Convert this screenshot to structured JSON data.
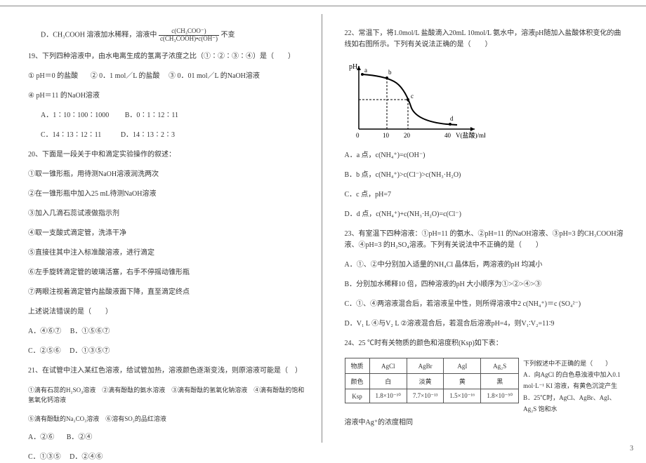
{
  "page_number": "3",
  "left": {
    "frac_num": "c(CH₃COO⁻)",
    "frac_den": "c(CH₃COOH)•c(OH⁻)",
    "optD_prefix": "D．CH₃COOH 溶液加水稀释，溶液中",
    "optD_suffix": "不变",
    "q19_stem": "19、下列四种溶液中，由水电离生成的氢离子浓度之比（①∶②∶③∶④）是（　　）",
    "q19_1": "① pH＝0 的盐酸",
    "q19_2": "② 0．1 mol／L 的盐酸",
    "q19_3": "③ 0．01 mol／L 的NaOH溶液",
    "q19_4": "④ pH＝11 的NaOH溶液",
    "q19_optA": "A．1∶10∶100∶1000",
    "q19_optB": "B．0∶1∶12∶11",
    "q19_optC": "C．14∶13∶12∶11",
    "q19_optD": "D．14∶13∶2∶3",
    "q20_stem": "20、下面是一段关于中和滴定实验操作的叙述：",
    "q20_1": "①取一锥形瓶，用待测NaOH溶液润洗两次",
    "q20_2": "②在一锥形瓶中加入25 mL待测NaOH溶液",
    "q20_3": "③加入几滴石蕊试液做指示剂",
    "q20_4": "④取一支酸式滴定管，洗涤干净",
    "q20_5": "⑤直接往其中注入标准酸溶液，进行滴定",
    "q20_6": "⑥左手旋转滴定管的玻璃活塞，右手不停摇动锥形瓶",
    "q20_7": "⑦两眼注视着滴定管内盐酸液面下降，直至滴定终点",
    "q20_tail": "上述说法错误的是（　　）",
    "q20_optA": "A．④⑥⑦",
    "q20_optB": "B．①⑤⑥⑦",
    "q20_optC": "C．②⑤⑥",
    "q20_optD": "D．①③⑤⑦",
    "q21_stem": "21、在试管中注入某红色溶液，给试管加热，溶液颜色逐渐变浅，则原溶液可能是（　）",
    "q21_opts_line1": "①滴有石蕊的H₂SO₄溶液　②滴有酚酞的氨水溶液　③滴有酚酞的氢氧化钠溶液　④滴有酚酞的饱和氢氧化钙溶液",
    "q21_opts_line2": "⑤滴有酚酞的Na₂CO₃溶液　⑥溶有SO₂的品红溶液",
    "q21_optA": "A．②⑥",
    "q21_optB": "B．②④",
    "q21_optC": "C．①③⑤",
    "q21_optD": "D．②④⑥"
  },
  "right": {
    "q22_stem": "22、常温下，将1.0mol/L 盐酸滴入20mL 10mol/L 氨水中，溶液pH随加入盐酸体积变化的曲线如右图所示。下列有关说法正确的是（　　）",
    "chart_ylabel": "pH",
    "chart_xlabel": "V(盐酸)/mL",
    "q22_a": "A．a 点，c(NH₄⁺)=c(OH⁻)",
    "q22_b": "B．b 点，c(NH₄⁺)>c(Cl⁻)>c(NH₃·H₂O)",
    "q22_c": "C．c 点，pH=7",
    "q22_d": "D．d 点，c(NH₄⁺)+c(NH₃·H₂O)=c(Cl⁻)",
    "q23_stem": "23、有室温下四种溶液：①pH=11 的氨水、②pH=11 的NaOH溶液、③pH=3 的CH₃COOH溶液、④pH=3 的H₂SO₄溶液。下列有关说法中不正确的是（　　）",
    "q23_a": "A．①、②中分别加入适量的NH₄Cl 晶体后，两溶液的pH 均减小",
    "q23_b": "B．分别加水稀释10 倍，四种溶液的pH 大小顺序为①>②>④>③",
    "q23_c": "C．①、④两溶液混合后，若溶液呈中性，则所得溶液中2 c(NH₄⁺)＝c (SO₄²⁻)",
    "q23_d": "D．V₁ L ④与V₂ L ②溶液混合后，若混合后溶液pH=4，则V₁∶V₂=11∶9",
    "q24_stem": "24、25 ℃时有关物质的颜色和溶度积(Ksp)如下表：",
    "q24_th1": "物质",
    "q24_c1_1": "AgCl",
    "q24_c1_2": "AgBr",
    "q24_c1_3": "AgI",
    "q24_c1_4": "Ag₂S",
    "q24_th2": "颜色",
    "q24_c2_1": "白",
    "q24_c2_2": "淡黄",
    "q24_c2_3": "黄",
    "q24_c2_4": "黑",
    "q24_th3": "Ksp",
    "q24_c3_1": "1.8×10⁻¹⁰",
    "q24_c3_2": "7.7×10⁻¹³",
    "q24_c3_3": "1.5×10⁻¹⁶",
    "q24_c3_4": "1.8×10⁻⁵⁰",
    "q24_side1": "下列叙述中不正确的是（　　）",
    "q24_side2": "A．向AgCl 的白色悬浊液中加入0.1 mol·L⁻¹ KI 溶液，有黄色沉淀产生",
    "q24_side3": "B．25℃时，AgCl、AgBr、AgI、Ag₂S 饱和水",
    "q24_tail": "溶液中Ag⁺的浓度相同"
  },
  "chart_data": {
    "type": "line",
    "xlabel": "V(盐酸)/mL",
    "ylabel": "pH",
    "points_labeled": [
      "a",
      "b",
      "c",
      "d"
    ],
    "x": [
      0,
      10,
      20,
      40
    ],
    "y_est": [
      12,
      11,
      9,
      4
    ],
    "x_ticks": [
      0,
      10,
      20,
      40
    ],
    "annotations": [
      "curve decreasing, S-shape; dashed guides at x=10,20 and a horizontal guide through c"
    ]
  }
}
